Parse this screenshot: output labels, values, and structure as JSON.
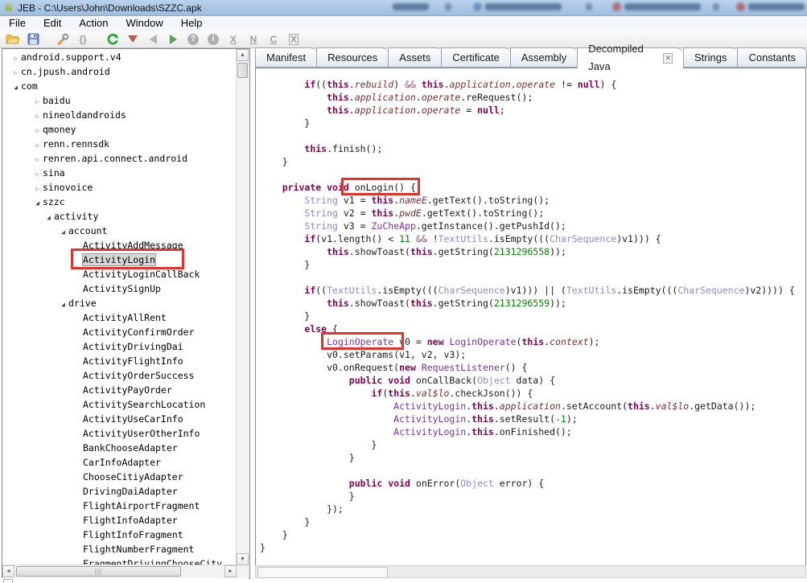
{
  "window": {
    "title": "JEB - C:\\Users\\John\\Downloads\\SZZC.apk"
  },
  "menu": {
    "items": [
      "File",
      "Edit",
      "Action",
      "Window",
      "Help"
    ]
  },
  "toolbar": {
    "icons": [
      {
        "name": "open-file-icon"
      },
      {
        "name": "save-icon"
      },
      {
        "name": "options-wrench-icon"
      },
      {
        "name": "braces-icon",
        "glyph": "{}"
      },
      {
        "name": "refresh-icon"
      },
      {
        "name": "navigate-down-icon"
      },
      {
        "name": "navigate-back-icon"
      },
      {
        "name": "navigate-forward-icon"
      },
      {
        "name": "help-icon",
        "glyph": "?"
      },
      {
        "name": "info-icon",
        "glyph": "i"
      },
      {
        "name": "xref-icon",
        "glyph": "X"
      },
      {
        "name": "rename-icon",
        "glyph": "N"
      },
      {
        "name": "comment-icon",
        "glyph": "C"
      },
      {
        "name": "decompile-icon",
        "glyph": "X"
      }
    ]
  },
  "tabbar": {
    "close_glyph": "✕",
    "tabs": [
      {
        "label": "Manifest"
      },
      {
        "label": "Resources"
      },
      {
        "label": "Assets"
      },
      {
        "label": "Certificate"
      },
      {
        "label": "Assembly"
      },
      {
        "label": "Decompiled Java",
        "active": true,
        "closable": true
      },
      {
        "label": "Strings"
      },
      {
        "label": "Constants"
      }
    ]
  },
  "tree": {
    "expander_collapsed": "▷",
    "expander_expanded": "◢",
    "items": [
      {
        "label": "android.support.v4",
        "depth": 0,
        "state": "collapsed"
      },
      {
        "label": "cn.jpush.android",
        "depth": 0,
        "state": "collapsed"
      },
      {
        "label": "com",
        "depth": 0,
        "state": "expanded"
      },
      {
        "label": "baidu",
        "depth": 1,
        "state": "collapsed"
      },
      {
        "label": "nineoldandroids",
        "depth": 1,
        "state": "collapsed"
      },
      {
        "label": "qmoney",
        "depth": 1,
        "state": "collapsed"
      },
      {
        "label": "renn.rennsdk",
        "depth": 1,
        "state": "collapsed"
      },
      {
        "label": "renren.api.connect.android",
        "depth": 1,
        "state": "collapsed"
      },
      {
        "label": "sina",
        "depth": 1,
        "state": "collapsed"
      },
      {
        "label": "sinovoice",
        "depth": 1,
        "state": "collapsed"
      },
      {
        "label": "szzc",
        "depth": 1,
        "state": "expanded"
      },
      {
        "label": "activity",
        "depth": 2,
        "state": "expanded"
      },
      {
        "label": "account",
        "depth": 3,
        "state": "expanded"
      },
      {
        "label": "ActivityAddMessage",
        "depth": 4,
        "state": "leaf"
      },
      {
        "label": "ActivityLogin",
        "depth": 4,
        "state": "leaf",
        "selected": true,
        "annotated": true
      },
      {
        "label": "ActivityLoginCallBack",
        "depth": 4,
        "state": "leaf"
      },
      {
        "label": "ActivitySignUp",
        "depth": 4,
        "state": "leaf"
      },
      {
        "label": "drive",
        "depth": 3,
        "state": "expanded"
      },
      {
        "label": "ActivityAllRent",
        "depth": 4,
        "state": "leaf"
      },
      {
        "label": "ActivityConfirmOrder",
        "depth": 4,
        "state": "leaf"
      },
      {
        "label": "ActivityDrivingDai",
        "depth": 4,
        "state": "leaf"
      },
      {
        "label": "ActivityFlightInfo",
        "depth": 4,
        "state": "leaf"
      },
      {
        "label": "ActivityOrderSuccess",
        "depth": 4,
        "state": "leaf"
      },
      {
        "label": "ActivityPayOrder",
        "depth": 4,
        "state": "leaf"
      },
      {
        "label": "ActivitySearchLocation",
        "depth": 4,
        "state": "leaf"
      },
      {
        "label": "ActivityUseCarInfo",
        "depth": 4,
        "state": "leaf"
      },
      {
        "label": "ActivityUserOtherInfo",
        "depth": 4,
        "state": "leaf"
      },
      {
        "label": "BankChooseAdapter",
        "depth": 4,
        "state": "leaf"
      },
      {
        "label": "CarInfoAdapter",
        "depth": 4,
        "state": "leaf"
      },
      {
        "label": "ChooseCitiyAdapter",
        "depth": 4,
        "state": "leaf"
      },
      {
        "label": "DrivingDaiAdapter",
        "depth": 4,
        "state": "leaf"
      },
      {
        "label": "FlightAirportFragment",
        "depth": 4,
        "state": "leaf"
      },
      {
        "label": "FlightInfoAdapter",
        "depth": 4,
        "state": "leaf"
      },
      {
        "label": "FlightInfoFragment",
        "depth": 4,
        "state": "leaf"
      },
      {
        "label": "FlightNumberFragment",
        "depth": 4,
        "state": "leaf"
      },
      {
        "label": "FragmentDrivingChooseCity",
        "depth": 4,
        "state": "leaf"
      }
    ]
  },
  "code": {
    "lines": [
      [
        [
          "p",
          "        "
        ],
        [
          "k",
          "if"
        ],
        [
          "p",
          "(("
        ],
        [
          "k",
          "this"
        ],
        [
          "p",
          "."
        ],
        [
          "f",
          "rebuild"
        ],
        [
          "p",
          ") "
        ],
        [
          "o",
          "&&"
        ],
        [
          "p",
          " "
        ],
        [
          "k",
          "this"
        ],
        [
          "p",
          "."
        ],
        [
          "f",
          "application"
        ],
        [
          "p",
          "."
        ],
        [
          "f",
          "operate"
        ],
        [
          "p",
          " != "
        ],
        [
          "k",
          "null"
        ],
        [
          "p",
          ") {"
        ]
      ],
      [
        [
          "p",
          "            "
        ],
        [
          "k",
          "this"
        ],
        [
          "p",
          "."
        ],
        [
          "f",
          "application"
        ],
        [
          "p",
          "."
        ],
        [
          "f",
          "operate"
        ],
        [
          "p",
          ".reRequest();"
        ]
      ],
      [
        [
          "p",
          "            "
        ],
        [
          "k",
          "this"
        ],
        [
          "p",
          "."
        ],
        [
          "f",
          "application"
        ],
        [
          "p",
          "."
        ],
        [
          "f",
          "operate"
        ],
        [
          "p",
          " = "
        ],
        [
          "k",
          "null"
        ],
        [
          "p",
          ";"
        ]
      ],
      [
        [
          "p",
          "        }"
        ]
      ],
      [],
      [
        [
          "p",
          "        "
        ],
        [
          "k",
          "this"
        ],
        [
          "p",
          ".finish();"
        ]
      ],
      [
        [
          "p",
          "    }"
        ]
      ],
      [],
      [
        [
          "p",
          "    "
        ],
        [
          "k",
          "private"
        ],
        [
          "p",
          " "
        ],
        [
          "k",
          "void"
        ],
        [
          "p",
          " "
        ],
        [
          "p",
          "onLogin() {",
          "ann-method"
        ]
      ],
      [
        [
          "p",
          "        "
        ],
        [
          "t",
          "String"
        ],
        [
          "p",
          " v1 = "
        ],
        [
          "k",
          "this"
        ],
        [
          "p",
          "."
        ],
        [
          "f",
          "nameE"
        ],
        [
          "p",
          ".getText().toString();"
        ]
      ],
      [
        [
          "p",
          "        "
        ],
        [
          "t",
          "String"
        ],
        [
          "p",
          " v2 = "
        ],
        [
          "k",
          "this"
        ],
        [
          "p",
          "."
        ],
        [
          "f",
          "pwdE"
        ],
        [
          "p",
          ".getText().toString();"
        ]
      ],
      [
        [
          "p",
          "        "
        ],
        [
          "t",
          "String"
        ],
        [
          "p",
          " v3 = "
        ],
        [
          "c",
          "ZuCheApp"
        ],
        [
          "p",
          ".getInstance().getPushId();"
        ]
      ],
      [
        [
          "p",
          "        "
        ],
        [
          "k",
          "if"
        ],
        [
          "p",
          "(v1.length() < "
        ],
        [
          "n",
          "11"
        ],
        [
          "p",
          " "
        ],
        [
          "o",
          "&&"
        ],
        [
          "p",
          " !"
        ],
        [
          "t",
          "TextUtils"
        ],
        [
          "p",
          ".isEmpty((("
        ],
        [
          "t",
          "CharSequence"
        ],
        [
          "p",
          ")v1))) {"
        ]
      ],
      [
        [
          "p",
          "            "
        ],
        [
          "k",
          "this"
        ],
        [
          "p",
          ".showToast("
        ],
        [
          "k",
          "this"
        ],
        [
          "p",
          ".getString("
        ],
        [
          "n",
          "2131296558"
        ],
        [
          "p",
          "));"
        ]
      ],
      [
        [
          "p",
          "        }"
        ]
      ],
      [],
      [
        [
          "p",
          "        "
        ],
        [
          "k",
          "if"
        ],
        [
          "p",
          "(("
        ],
        [
          "t",
          "TextUtils"
        ],
        [
          "p",
          ".isEmpty((("
        ],
        [
          "t",
          "CharSequence"
        ],
        [
          "p",
          ")v1))) || ("
        ],
        [
          "t",
          "TextUtils"
        ],
        [
          "p",
          ".isEmpty((("
        ],
        [
          "t",
          "CharSequence"
        ],
        [
          "p",
          ")v2)))) {"
        ]
      ],
      [
        [
          "p",
          "            "
        ],
        [
          "k",
          "this"
        ],
        [
          "p",
          ".showToast("
        ],
        [
          "k",
          "this"
        ],
        [
          "p",
          ".getString("
        ],
        [
          "n",
          "2131296559"
        ],
        [
          "p",
          "));"
        ]
      ],
      [
        [
          "p",
          "        }"
        ]
      ],
      [
        [
          "p",
          "        "
        ],
        [
          "k",
          "else"
        ],
        [
          "p",
          " {"
        ]
      ],
      [
        [
          "p",
          "            "
        ],
        [
          "c",
          "LoginOperate",
          "ann-class"
        ],
        [
          "p",
          " v0 = "
        ],
        [
          "k",
          "new"
        ],
        [
          "p",
          " "
        ],
        [
          "c",
          "LoginOperate"
        ],
        [
          "p",
          "("
        ],
        [
          "k",
          "this"
        ],
        [
          "p",
          "."
        ],
        [
          "f",
          "context"
        ],
        [
          "p",
          ");"
        ]
      ],
      [
        [
          "p",
          "            v0.setParams(v1, v2, v3);"
        ]
      ],
      [
        [
          "p",
          "            v0.onRequest("
        ],
        [
          "k",
          "new"
        ],
        [
          "p",
          " "
        ],
        [
          "c",
          "RequestListener"
        ],
        [
          "p",
          "() {"
        ]
      ],
      [
        [
          "p",
          "                "
        ],
        [
          "k",
          "public"
        ],
        [
          "p",
          " "
        ],
        [
          "k",
          "void"
        ],
        [
          "p",
          " onCallBack("
        ],
        [
          "t",
          "Object"
        ],
        [
          "p",
          " data) {"
        ]
      ],
      [
        [
          "p",
          "                    "
        ],
        [
          "k",
          "if"
        ],
        [
          "p",
          "("
        ],
        [
          "k",
          "this"
        ],
        [
          "p",
          "."
        ],
        [
          "f",
          "val$lo"
        ],
        [
          "p",
          ".checkJson()) {"
        ]
      ],
      [
        [
          "p",
          "                        "
        ],
        [
          "c",
          "ActivityLogin"
        ],
        [
          "p",
          "."
        ],
        [
          "k",
          "this"
        ],
        [
          "p",
          "."
        ],
        [
          "f",
          "application"
        ],
        [
          "p",
          ".setAccount("
        ],
        [
          "k",
          "this"
        ],
        [
          "p",
          "."
        ],
        [
          "f",
          "val$lo"
        ],
        [
          "p",
          ".getData());"
        ]
      ],
      [
        [
          "p",
          "                        "
        ],
        [
          "c",
          "ActivityLogin"
        ],
        [
          "p",
          "."
        ],
        [
          "k",
          "this"
        ],
        [
          "p",
          ".setResult("
        ],
        [
          "n",
          "-1"
        ],
        [
          "p",
          ");"
        ]
      ],
      [
        [
          "p",
          "                        "
        ],
        [
          "c",
          "ActivityLogin"
        ],
        [
          "p",
          "."
        ],
        [
          "k",
          "this"
        ],
        [
          "p",
          ".onFinished();"
        ]
      ],
      [
        [
          "p",
          "                    }"
        ]
      ],
      [
        [
          "p",
          "                }"
        ]
      ],
      [],
      [
        [
          "p",
          "                "
        ],
        [
          "k",
          "public"
        ],
        [
          "p",
          " "
        ],
        [
          "k",
          "void"
        ],
        [
          "p",
          " onError("
        ],
        [
          "t",
          "Object"
        ],
        [
          "p",
          " error) {"
        ]
      ],
      [
        [
          "p",
          "                }"
        ]
      ],
      [
        [
          "p",
          "            });"
        ]
      ],
      [
        [
          "p",
          "        }"
        ]
      ],
      [
        [
          "p",
          "    }"
        ]
      ],
      [
        [
          "p",
          "}"
        ]
      ]
    ]
  },
  "colors": {
    "keyword": "#7F0055",
    "library_type": "#8A8AD6",
    "app_class": "#7C2FA8",
    "field": "#7A3030",
    "number": "#007F00",
    "annotation_red": "#E5322A",
    "titlebar_blue": "#A9C5E4",
    "selection_gray": "#D8D8D8"
  }
}
